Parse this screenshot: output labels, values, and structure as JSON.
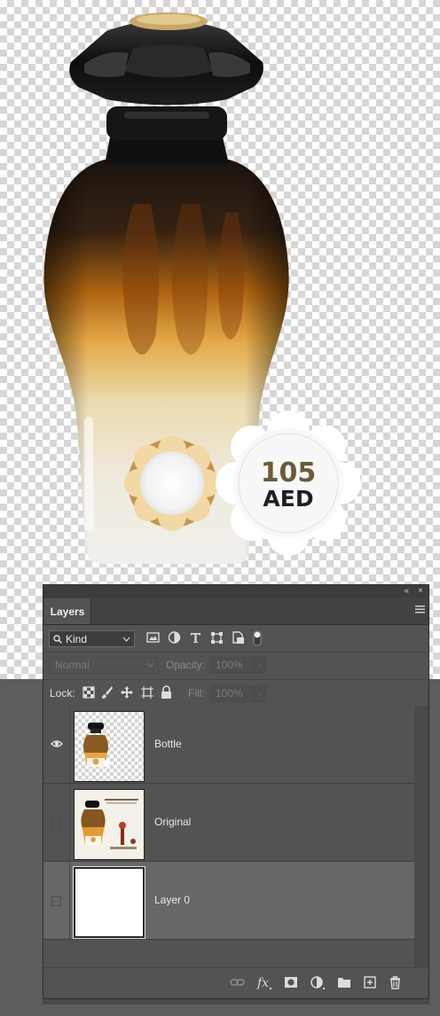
{
  "canvas": {
    "price_badge": {
      "amount": "105",
      "currency": "AED"
    }
  },
  "panel": {
    "collapse_label": "«",
    "close_label": "×",
    "tab_label": "Layers",
    "filter": {
      "kind_label": "Kind",
      "icons": [
        "image-filter-icon",
        "adjustment-filter-icon",
        "type-filter-icon",
        "shape-filter-icon",
        "smart-object-filter-icon",
        "filter-toggle-icon"
      ]
    },
    "blend": {
      "mode": "Normal",
      "opacity_label": "Opacity:",
      "opacity_value": "100%",
      "fill_label": "Fill:",
      "fill_value": "100%"
    },
    "lock": {
      "label": "Lock:",
      "icons": [
        "lock-transparent-pixels-icon",
        "lock-image-pixels-icon",
        "lock-position-icon",
        "lock-artboard-icon",
        "lock-all-icon"
      ]
    },
    "layers": [
      {
        "name": "Bottle",
        "visible": true,
        "selected": false
      },
      {
        "name": "Original",
        "visible": false,
        "selected": false
      },
      {
        "name": "Layer 0",
        "visible": false,
        "selected": true
      }
    ],
    "bottom_icons": [
      "link-layers-icon",
      "fx-icon",
      "add-mask-icon",
      "adjustment-layer-icon",
      "new-group-folder-icon",
      "new-layer-icon",
      "trash-icon"
    ]
  }
}
